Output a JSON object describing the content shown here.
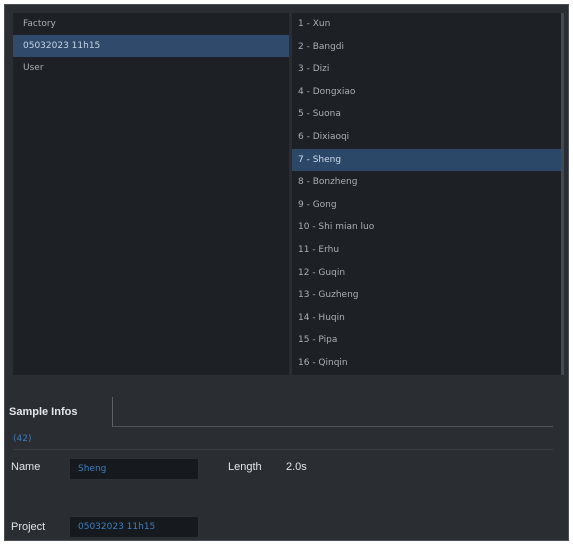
{
  "folders": [
    {
      "label": "Factory",
      "selected": false
    },
    {
      "label": "05032023 11h15",
      "selected": true
    },
    {
      "label": "User",
      "selected": false
    }
  ],
  "samples": [
    {
      "label": "1 - Xun",
      "selected": false
    },
    {
      "label": "2 - Bangdi",
      "selected": false
    },
    {
      "label": "3 - Dizi",
      "selected": false
    },
    {
      "label": "4 - Dongxiao",
      "selected": false
    },
    {
      "label": "5 - Suona",
      "selected": false
    },
    {
      "label": "6 - Dixiaoqi",
      "selected": false
    },
    {
      "label": "7 - Sheng",
      "selected": true
    },
    {
      "label": "8 - Bonzheng",
      "selected": false
    },
    {
      "label": "9 - Gong",
      "selected": false
    },
    {
      "label": "10 - Shi mian luo",
      "selected": false
    },
    {
      "label": "11 - Erhu",
      "selected": false
    },
    {
      "label": "12 - Guqin",
      "selected": false
    },
    {
      "label": "13 - Guzheng",
      "selected": false
    },
    {
      "label": "14 - Huqin",
      "selected": false
    },
    {
      "label": "15 - Pipa",
      "selected": false
    },
    {
      "label": "16 - Qinqin",
      "selected": false
    }
  ],
  "info": {
    "tab_label": "Sample Infos",
    "number": "(42)",
    "name_label": "Name",
    "name_value": "Sheng",
    "length_label": "Length",
    "length_value": "2.0s",
    "project_label": "Project",
    "project_value": "05032023 11h15"
  }
}
